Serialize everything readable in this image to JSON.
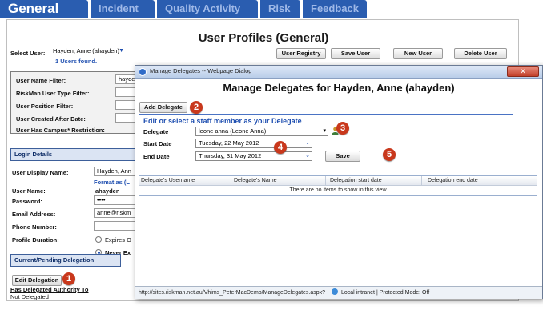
{
  "tabs": [
    {
      "label": "General",
      "active": true
    },
    {
      "label": "Incident",
      "active": false
    },
    {
      "label": "Quality Activity",
      "active": false
    },
    {
      "label": "Risk",
      "active": false
    },
    {
      "label": "Feedback",
      "active": false
    }
  ],
  "page": {
    "title": "User Profiles (General)",
    "select_user_label": "Select User:",
    "selected_user": "Hayden, Anne (ahayden)",
    "users_found": "1 Users found.",
    "buttons": {
      "user_registry": "User Registry",
      "save_user": "Save User",
      "new_user": "New User",
      "delete_user": "Delete User"
    },
    "filters": {
      "user_name_filter": "User Name Filter:",
      "user_name_value": "hayde",
      "riskman_type_filter": "RiskMan User Type Filter:",
      "position_filter": "User Position Filter:",
      "created_after": "User Created After Date:",
      "campus_restriction": "User Has Campus* Restriction:"
    },
    "login_details": {
      "header": "Login Details",
      "display_name_label": "User Display Name:",
      "display_name_value": "Hayden, Ann",
      "format_hint": "Format as (L",
      "user_name_label": "User Name:",
      "user_name_value": "ahayden",
      "password_label": "Password:",
      "password_value": "••••",
      "email_label": "Email Address:",
      "email_value": "anne@riskm",
      "phone_label": "Phone Number:",
      "profile_duration_label": "Profile Duration:",
      "expires_option": "Expires O",
      "never_option": "Never Ex"
    },
    "delegation": {
      "header": "Current/Pending Delegation",
      "edit_button": "Edit Delegation",
      "has_delegated_label": "Has Delegated Authority To",
      "status_value": "Not Delegated"
    }
  },
  "dialog": {
    "window_title": "Manage Delegates -- Webpage Dialog",
    "heading": "Manage Delegates for Hayden, Anne (ahayden)",
    "add_delegate_button": "Add Delegate",
    "edit_title": "Edit or select a staff member as your Delegate",
    "delegate_label": "Delegate",
    "delegate_value": "leone anna (Leone Anna)",
    "start_date_label": "Start Date",
    "start_date_value": "Tuesday, 22 May 2012",
    "end_date_label": "End Date",
    "end_date_value": "Thursday, 31 May 2012",
    "save_button": "Save",
    "grid_columns": [
      "Delegate's Username",
      "Delegate's Name",
      "Delegation start date",
      "Delegation end date"
    ],
    "empty_message": "There are no items to show in this view",
    "status_url": "http://sites.riskman.net.au/Vhims_PeterMacDemo/ManageDelegates.aspx?",
    "status_zone": "Local intranet | Protected Mode: Off"
  },
  "callouts": [
    "1",
    "2",
    "3",
    "4",
    "5"
  ],
  "colors": {
    "tab_bg": "#2a5db0",
    "callout": "#c9381c",
    "link_blue": "#1f4fb0"
  }
}
